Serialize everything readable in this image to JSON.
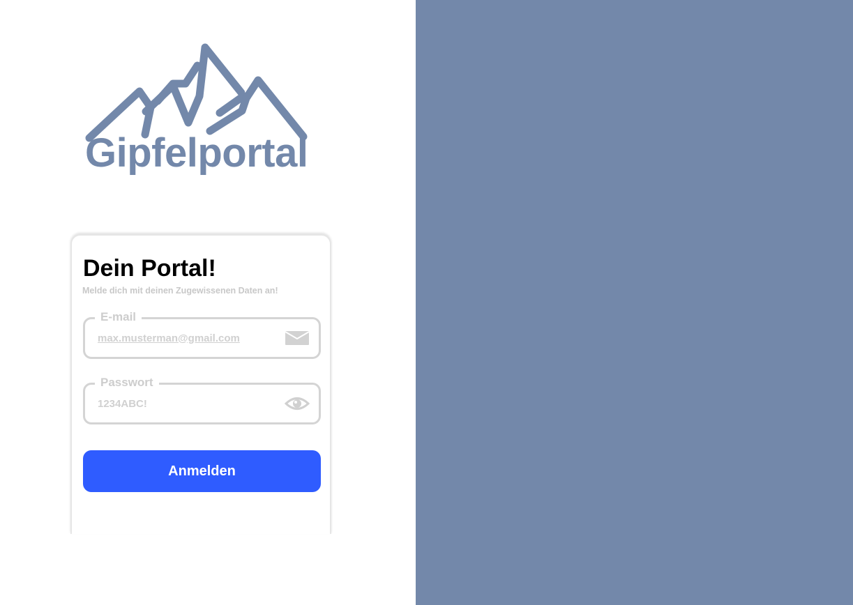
{
  "brand": {
    "name": "Gipfelportal",
    "logo_icon": "mountain-logo-icon",
    "color": "#7388aa"
  },
  "side_panel": {
    "background": "#7388aa"
  },
  "login": {
    "title": "Dein Portal!",
    "subtitle": "Melde dich mit deinen Zugewissenen Daten an!",
    "email": {
      "label": "E-mail",
      "placeholder": "max.musterman@gmail.com",
      "value": "",
      "icon": "envelope-icon"
    },
    "password": {
      "label": "Passwort",
      "placeholder": "1234ABC!",
      "value": "",
      "icon": "eye-icon"
    },
    "submit_label": "Anmelden",
    "accent": "#2f5cff"
  }
}
